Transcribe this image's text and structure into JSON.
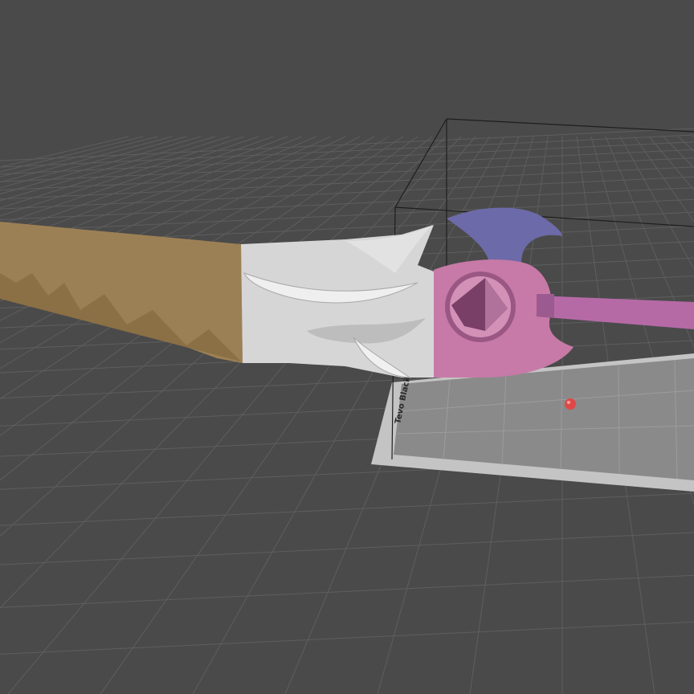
{
  "app": {
    "viewport_name": "3d-slicer-viewport"
  },
  "colors": {
    "background": "#4a4a4a",
    "grid_line": "#5e5e5e",
    "bed_surface": "#8a8a8a",
    "bed_edge": "#c4c4c4",
    "build_volume_line": "#1e1e1e",
    "blade_top": "#9c8055",
    "blade_side": "#8b6f45",
    "guard": "#d6d6d6",
    "hub": "#c77aa7",
    "hub_dark": "#9a5783",
    "axe_head": "#6c6aa8",
    "shaft": "#b56aa6",
    "origin_marker": "#e04848"
  },
  "bed": {
    "label": "Tevo Black Widow"
  },
  "icons": {
    "origin": "red-sphere-icon"
  }
}
